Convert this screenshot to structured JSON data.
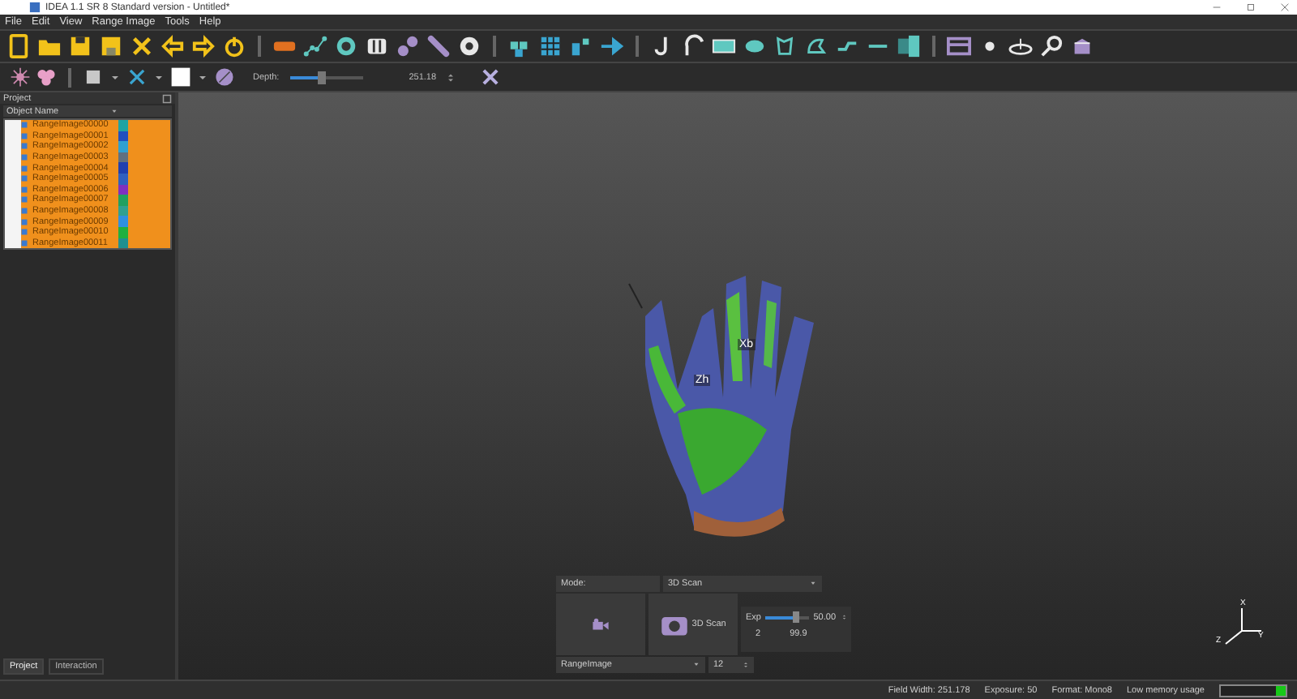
{
  "window": {
    "title": "IDEA 1.1 SR 8 Standard version - Untitled*"
  },
  "menu": [
    "File",
    "Edit",
    "View",
    "Range Image",
    "Tools",
    "Help"
  ],
  "toolbar2": {
    "depth_label": "Depth:",
    "depth": {
      "level": 0.45
    },
    "depth_value": "251.18"
  },
  "project_panel": {
    "title": "Project",
    "column": "Object Name",
    "items": [
      {
        "name": "RangeImage00000",
        "color": "#1fa3a3",
        "selected": true
      },
      {
        "name": "RangeImage00001",
        "color": "#2050c0",
        "selected": true
      },
      {
        "name": "RangeImage00002",
        "color": "#30a0d0",
        "selected": true
      },
      {
        "name": "RangeImage00003",
        "color": "#607080",
        "selected": true
      },
      {
        "name": "RangeImage00004",
        "color": "#2040b0",
        "selected": true
      },
      {
        "name": "RangeImage00005",
        "color": "#3060c0",
        "selected": true
      },
      {
        "name": "RangeImage00006",
        "color": "#8030c0",
        "selected": true
      },
      {
        "name": "RangeImage00007",
        "color": "#20a060",
        "selected": true
      },
      {
        "name": "RangeImage00008",
        "color": "#30a090",
        "selected": true
      },
      {
        "name": "RangeImage00009",
        "color": "#3090e0",
        "selected": true
      },
      {
        "name": "RangeImage00010",
        "color": "#20b040",
        "selected": true
      },
      {
        "name": "RangeImage00011",
        "color": "#209090",
        "selected": true
      }
    ]
  },
  "tabs": [
    {
      "label": "Project",
      "selected": true
    },
    {
      "label": "Interaction",
      "selected": false
    }
  ],
  "viewport": {
    "labels": [
      "Xb",
      "Zh"
    ],
    "axes": [
      "X",
      "Y",
      "Z"
    ]
  },
  "scan_controls": {
    "mode_label": "Mode:",
    "mode": "3D Scan",
    "scan_button": "3D Scan",
    "exp_label": "Exp",
    "exp": {
      "level": 0.7
    },
    "exp_value": "50.00",
    "exp_min": "2",
    "exp_max": "99.9",
    "source": "RangeImage",
    "count": "12"
  },
  "status_bar": {
    "items": [
      "Field Width: 251.178",
      "Exposure: 50",
      "Format: Mono8",
      "Low memory usage"
    ],
    "memory": {
      "level": 0.15
    }
  }
}
